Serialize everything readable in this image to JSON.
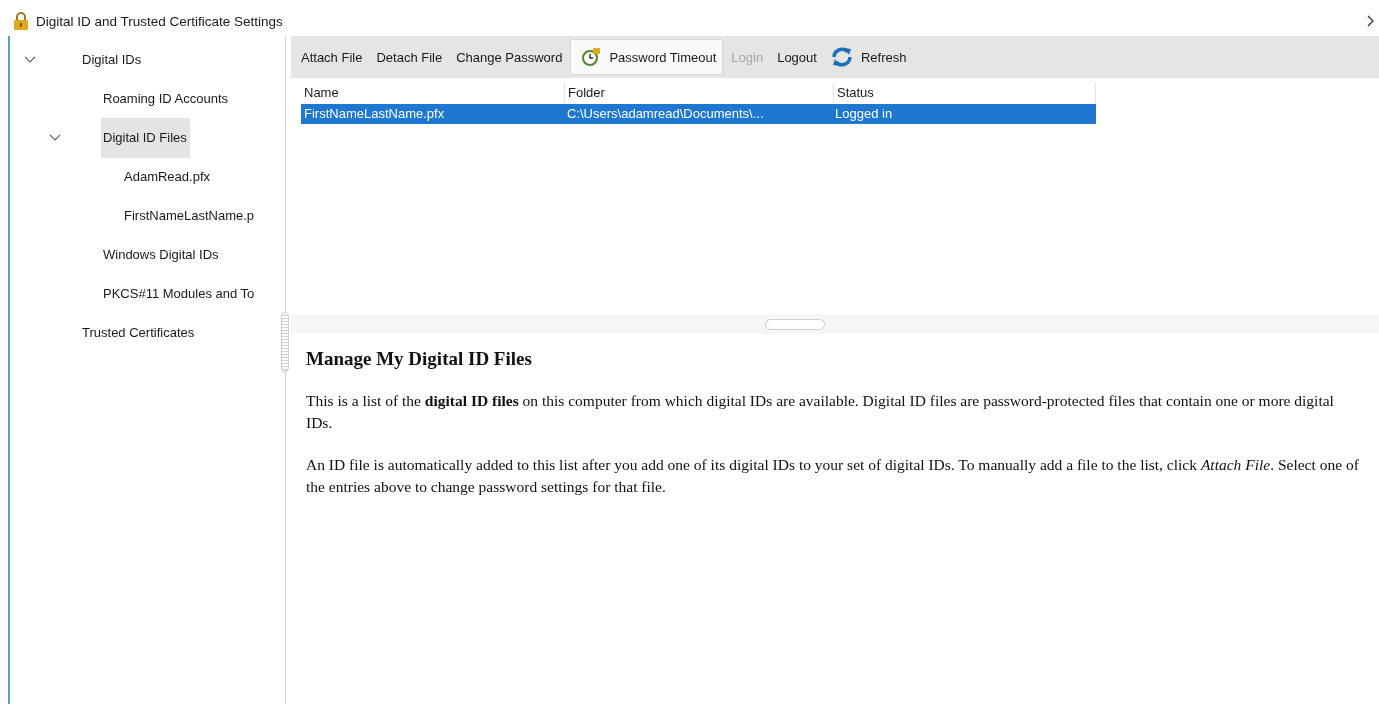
{
  "window": {
    "title": "Digital ID and Trusted Certificate Settings"
  },
  "tree": [
    {
      "label": "Digital IDs",
      "expanded": true,
      "selected": false,
      "children": [
        {
          "label": "Roaming ID Accounts",
          "selected": false
        },
        {
          "label": "Digital ID Files",
          "expanded": true,
          "selected": true,
          "children": [
            {
              "label": "AdamRead.pfx",
              "selected": false
            },
            {
              "label": "FirstNameLastName.p",
              "selected": false
            }
          ]
        },
        {
          "label": "Windows Digital IDs",
          "selected": false
        },
        {
          "label": "PKCS#11 Modules and To",
          "selected": false
        }
      ]
    },
    {
      "label": "Trusted Certificates",
      "selected": false
    }
  ],
  "toolbar": [
    {
      "label": "Attach File",
      "disabled": false,
      "hovered": false
    },
    {
      "label": "Detach File",
      "disabled": false,
      "hovered": false
    },
    {
      "label": "Change Password",
      "disabled": false,
      "hovered": false
    },
    {
      "label": "Password Timeout",
      "disabled": false,
      "hovered": true
    },
    {
      "label": "Login",
      "disabled": true,
      "hovered": false
    },
    {
      "label": "Logout",
      "disabled": false,
      "hovered": false
    },
    {
      "label": "Refresh",
      "disabled": false,
      "hovered": false
    }
  ],
  "table": {
    "columns": [
      "Name",
      "Folder",
      "Status"
    ],
    "rows": [
      {
        "cells": [
          "FirstNameLastName.pfx",
          "C:\\Users\\adamread\\Documents\\...",
          "Logged in"
        ],
        "selected": true
      }
    ]
  },
  "help": {
    "heading": "Manage My Digital ID Files",
    "paragraphs": [
      "This is a list of the **digital ID files** on this computer from which digital IDs are available. Digital ID files are password-protected files that contain one or more digital IDs.",
      "An ID file is automatically added to this list after you add one of its digital IDs to your set of digital IDs. To manually add a file to the list, click *Attach File*. Select one of the entries above to change password settings for that file."
    ]
  }
}
